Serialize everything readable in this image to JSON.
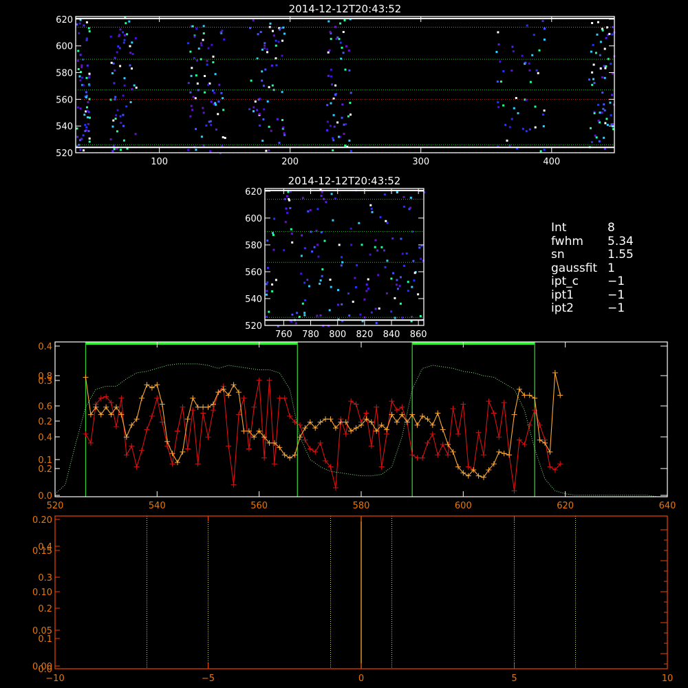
{
  "info_panel": [
    {
      "key": "Int",
      "value": "8"
    },
    {
      "key": "fwhm",
      "value": "5.34"
    },
    {
      "key": "sn",
      "value": "1.55"
    },
    {
      "key": "gaussfit",
      "value": "1"
    },
    {
      "key": "ipt_c",
      "value": "−1"
    },
    {
      "key": "ipt1",
      "value": "−1"
    },
    {
      "key": "ipt2",
      "value": "−1"
    }
  ],
  "chart_data": [
    {
      "type": "heatmap",
      "title": "2014-12-12T20:43:52",
      "xlim": [
        36,
        448
      ],
      "ylim": [
        520,
        622
      ],
      "xticks": [
        100,
        200,
        300,
        400
      ],
      "yticks": [
        520,
        540,
        560,
        580,
        600,
        620
      ],
      "hlines": [
        {
          "y": 620.5,
          "color": "#ffffff",
          "style": "solid"
        },
        {
          "y": 614,
          "color": "#22cc22",
          "style": "dotted"
        },
        {
          "y": 590,
          "color": "#22cc22",
          "style": "dotted"
        },
        {
          "y": 567,
          "color": "#22cc22",
          "style": "dotted"
        },
        {
          "y": 560,
          "color": "#cc2222",
          "style": "dotted"
        },
        {
          "y": 526,
          "color": "#22cc22",
          "style": "dotted"
        },
        {
          "y": 524,
          "color": "#ffffff",
          "style": "solid"
        }
      ],
      "column_bands": [
        [
          36,
          46
        ],
        [
          62,
          82
        ],
        [
          120,
          150
        ],
        [
          168,
          195
        ],
        [
          227,
          246
        ],
        [
          357,
          395
        ],
        [
          428,
          448
        ]
      ],
      "point_colors": [
        "#4411dd",
        "#5522ee",
        "#2233ff",
        "#6611cc",
        "#33ccff",
        "#22ff99",
        "#ffffff",
        "#4455ff"
      ]
    },
    {
      "type": "heatmap",
      "title": "2014-12-12T20:43:52",
      "xlim": [
        746,
        864
      ],
      "ylim": [
        520,
        622
      ],
      "xticks": [
        760,
        780,
        800,
        820,
        840,
        860
      ],
      "yticks": [
        520,
        540,
        560,
        580,
        600,
        620
      ],
      "hlines": [
        {
          "y": 620.5,
          "color": "#ffffff",
          "style": "solid"
        },
        {
          "y": 614,
          "color": "#22cc22",
          "style": "dotted"
        },
        {
          "y": 590,
          "color": "#22cc22",
          "style": "dotted"
        },
        {
          "y": 567,
          "color": "#22cc22",
          "style": "dotted"
        },
        {
          "y": 526,
          "color": "#22cc22",
          "style": "dotted"
        },
        {
          "y": 524,
          "color": "#ffffff",
          "style": "solid"
        }
      ],
      "point_colors": [
        "#4411dd",
        "#5522ee",
        "#2233ff",
        "#6611cc",
        "#33ccff",
        "#22ff99",
        "#ffffff",
        "#4455ff"
      ]
    },
    {
      "type": "line",
      "xlim": [
        520,
        640
      ],
      "xticks": [
        520,
        540,
        560,
        580,
        600,
        620,
        640
      ],
      "left_axis_labels": [
        {
          "text": "0.4",
          "value": 0.0
        },
        {
          "text": "0.8",
          "value": 0.0
        },
        {
          "text": "0.3",
          "value": 0.0
        },
        {
          "text": "0.6",
          "value": 0.0
        },
        {
          "text": "0.2",
          "value": 0.0
        },
        {
          "text": "0.4",
          "value": 0.0
        },
        {
          "text": "0.1",
          "value": 0.0
        },
        {
          "text": "0.2",
          "value": 0.0
        },
        {
          "text": "0.0",
          "value": 0.0
        }
      ],
      "band_markers": [
        526,
        567.5,
        590,
        614
      ],
      "band_ranges": [
        [
          526,
          567.5
        ],
        [
          590,
          614
        ]
      ],
      "series": [
        {
          "color": "#dd1111",
          "x": [
            526,
            527,
            528,
            529,
            530,
            531,
            532,
            533,
            534,
            535,
            536,
            537,
            538,
            539,
            540,
            541,
            542,
            543,
            544,
            545,
            546,
            547,
            548,
            549,
            550,
            551,
            552,
            553,
            554,
            555,
            556,
            557,
            558,
            559,
            560,
            561,
            562,
            563,
            564,
            565,
            566,
            567,
            568,
            569,
            570,
            571,
            572,
            573,
            574,
            575,
            576,
            577,
            578,
            579,
            580,
            581,
            582,
            583,
            584,
            585,
            586,
            587,
            588,
            589,
            590,
            591,
            592,
            593,
            594,
            595,
            596,
            597,
            598,
            599,
            600,
            601,
            602,
            603,
            604,
            605,
            606,
            607,
            608,
            609,
            610,
            611,
            612,
            613,
            614,
            615,
            616,
            617,
            618,
            619
          ],
          "y": [
            0.42,
            0.36,
            0.62,
            0.66,
            0.67,
            0.63,
            0.47,
            0.66,
            0.28,
            0.34,
            0.2,
            0.31,
            0.45,
            0.54,
            0.66,
            0.5,
            0.34,
            0.22,
            0.44,
            0.6,
            0.32,
            0.58,
            0.22,
            0.56,
            0.4,
            0.58,
            0.7,
            0.74,
            0.34,
            0.08,
            0.55,
            0.66,
            0.32,
            0.6,
            0.78,
            0.26,
            0.78,
            0.22,
            0.66,
            0.66,
            0.54,
            0.5,
            0.48,
            0.38,
            0.32,
            0.3,
            0.36,
            0.24,
            0.2,
            0.06,
            0.52,
            0.42,
            0.64,
            0.62,
            0.5,
            0.56,
            0.34,
            0.6,
            0.2,
            0.42,
            0.64,
            0.58,
            0.6,
            0.5,
            0.28,
            0.26,
            0.26,
            0.36,
            0.42,
            0.28,
            0.35,
            0.28,
            0.59,
            0.42,
            0.62,
            0.2,
            0.18,
            0.43,
            0.28,
            0.64,
            0.56,
            0.4,
            0.63,
            0.28,
            0.04,
            0.38,
            0.35,
            0.48,
            0.58,
            0.48,
            0.38,
            0.2,
            0.18,
            0.22
          ]
        },
        {
          "color": "#ffaa33",
          "x": [
            526,
            527,
            528,
            529,
            530,
            531,
            532,
            533,
            534,
            535,
            536,
            537,
            538,
            539,
            540,
            541,
            542,
            543,
            544,
            545,
            546,
            547,
            548,
            549,
            550,
            551,
            552,
            553,
            554,
            555,
            556,
            557,
            558,
            559,
            560,
            561,
            562,
            563,
            564,
            565,
            566,
            567,
            568,
            569,
            570,
            571,
            572,
            573,
            574,
            575,
            576,
            577,
            578,
            579,
            580,
            581,
            582,
            583,
            584,
            585,
            586,
            587,
            588,
            589,
            590,
            591,
            592,
            593,
            594,
            595,
            596,
            597,
            598,
            599,
            600,
            601,
            602,
            603,
            604,
            605,
            606,
            607,
            608,
            609,
            610,
            611,
            612,
            613,
            614,
            615,
            616,
            617,
            618,
            619
          ],
          "y": [
            0.8,
            0.55,
            0.6,
            0.55,
            0.6,
            0.55,
            0.6,
            0.55,
            0.4,
            0.48,
            0.52,
            0.66,
            0.75,
            0.73,
            0.75,
            0.62,
            0.37,
            0.29,
            0.23,
            0.3,
            0.52,
            0.66,
            0.6,
            0.6,
            0.6,
            0.62,
            0.7,
            0.72,
            0.68,
            0.75,
            0.7,
            0.44,
            0.44,
            0.4,
            0.44,
            0.4,
            0.36,
            0.36,
            0.33,
            0.28,
            0.26,
            0.28,
            0.4,
            0.46,
            0.5,
            0.46,
            0.5,
            0.52,
            0.52,
            0.46,
            0.5,
            0.5,
            0.44,
            0.46,
            0.48,
            0.52,
            0.5,
            0.44,
            0.48,
            0.45,
            0.55,
            0.5,
            0.55,
            0.5,
            0.55,
            0.48,
            0.54,
            0.52,
            0.48,
            0.56,
            0.45,
            0.35,
            0.3,
            0.2,
            0.16,
            0.14,
            0.18,
            0.14,
            0.13,
            0.18,
            0.22,
            0.3,
            0.29,
            0.28,
            0.55,
            0.72,
            0.68,
            0.68,
            0.66,
            0.38,
            0.36,
            0.3,
            0.83,
            0.68
          ]
        },
        {
          "color": "#88ee88",
          "style": "dotted",
          "x": [
            520,
            522,
            524,
            526,
            528,
            530,
            532,
            534,
            536,
            538,
            540,
            542,
            544,
            546,
            548,
            550,
            552,
            554,
            556,
            558,
            560,
            562,
            564,
            566,
            568,
            570,
            572,
            574,
            576,
            578,
            580,
            582,
            584,
            586,
            588,
            590,
            592,
            594,
            596,
            598,
            600,
            602,
            604,
            606,
            608,
            610,
            612,
            614,
            616,
            618,
            620,
            622,
            624,
            626,
            628,
            630,
            632,
            634,
            636,
            638,
            640
          ],
          "y": [
            0.02,
            0.08,
            0.35,
            0.6,
            0.72,
            0.74,
            0.74,
            0.79,
            0.83,
            0.84,
            0.86,
            0.88,
            0.89,
            0.89,
            0.89,
            0.88,
            0.86,
            0.88,
            0.87,
            0.86,
            0.85,
            0.85,
            0.83,
            0.72,
            0.4,
            0.25,
            0.2,
            0.17,
            0.16,
            0.15,
            0.14,
            0.14,
            0.15,
            0.2,
            0.4,
            0.72,
            0.86,
            0.88,
            0.87,
            0.86,
            0.84,
            0.83,
            0.81,
            0.8,
            0.76,
            0.72,
            0.58,
            0.32,
            0.12,
            0.04,
            0.02,
            0.01,
            0.01,
            0.01,
            0.01,
            0.01,
            0.01,
            0.01,
            0.01,
            0.0,
            0.0
          ]
        }
      ]
    },
    {
      "type": "line",
      "xlim": [
        -10,
        10
      ],
      "xticks": [
        -10,
        -5,
        0,
        5,
        10
      ],
      "xtick_labels": [
        "−10",
        "−5",
        "0",
        "5",
        "10"
      ],
      "left_axis_labels": [
        {
          "text": "0.20",
          "value": 0.0
        },
        {
          "text": "0.4",
          "value": 0.0
        },
        {
          "text": "0.15",
          "value": 0.0
        },
        {
          "text": "0.3",
          "value": 0.0
        },
        {
          "text": "0.10",
          "value": 0.0
        },
        {
          "text": "0.2",
          "value": 0.0
        },
        {
          "text": "0.05",
          "value": 0.0
        },
        {
          "text": "0.1",
          "value": 0.0
        },
        {
          "text": "0.00",
          "value": 0.0
        },
        {
          "text": "0.0",
          "value": 0.0
        }
      ],
      "vlines": [
        {
          "x": -7,
          "color": "#dddd66",
          "style": "dotted"
        },
        {
          "x": -5,
          "color": "#dddd66",
          "style": "dotted"
        },
        {
          "x": -1,
          "color": "#dddd66",
          "style": "dotted"
        },
        {
          "x": 0,
          "color": "#ffaa33",
          "style": "solid"
        },
        {
          "x": 1,
          "color": "#dddd66",
          "style": "dotted"
        },
        {
          "x": 5,
          "color": "#dddd66",
          "style": "dotted"
        },
        {
          "x": 7,
          "color": "#dddd66",
          "style": "dotted"
        }
      ]
    }
  ]
}
